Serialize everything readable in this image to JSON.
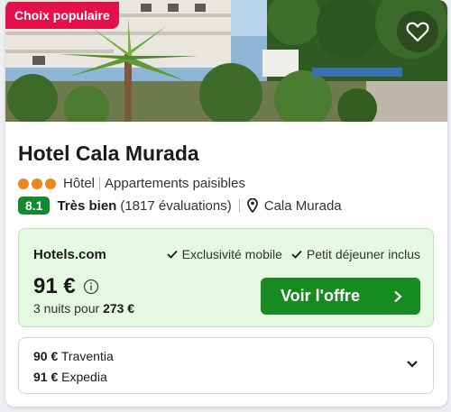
{
  "badge": "Choix populaire",
  "hotel": {
    "name": "Hotel Cala Murada",
    "star_count": 3,
    "type": "Hôtel",
    "tagline": "Appartements paisibles",
    "rating": "8.1",
    "rating_label": "Très bien",
    "reviews": "(1817 évaluations)",
    "location": "Cala Murada"
  },
  "offer": {
    "provider": "Hotels.com",
    "perks": [
      "Exclusivité mobile",
      "Petit déjeuner inclus"
    ],
    "price": "91 €",
    "nights_text": "3 nuits pour",
    "total": "273 €",
    "cta": "Voir l'offre"
  },
  "other_offers": [
    {
      "price": "90 €",
      "provider": "Traventia"
    },
    {
      "price": "91 €",
      "provider": "Expedia"
    }
  ],
  "icons": [
    "heart-icon",
    "info-icon",
    "location-pin-icon",
    "checkmark-icon",
    "chevron-right-icon",
    "chevron-down-icon"
  ],
  "colors": {
    "badge": "#e3114b",
    "score": "#128a2d",
    "cta": "#188a22",
    "offer_bg": "#e5f8e2",
    "stars": "#f0851f"
  }
}
